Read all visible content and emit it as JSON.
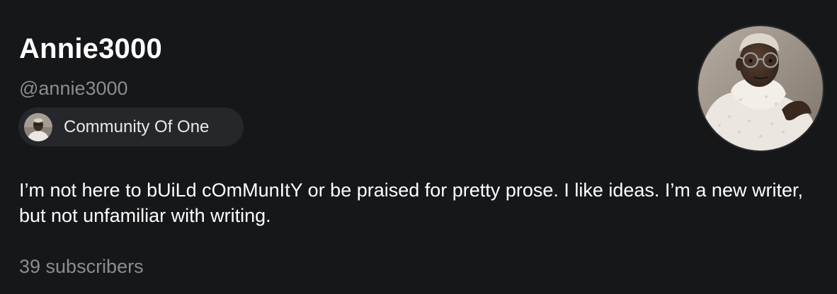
{
  "profile": {
    "display_name": "Annie3000",
    "handle": "@annie3000",
    "publication": {
      "name": "Community Of One"
    },
    "bio": "I’m not here to bUiLd cOmMunItY or be praised for pretty prose. I like ideas. I’m a new writer, but not unfamiliar with writing.",
    "subscribers": "39 subscribers"
  },
  "colors": {
    "background": "#161719",
    "chip_background": "#25272b",
    "muted_text": "#8c8c90",
    "primary_text": "#ffffff"
  }
}
